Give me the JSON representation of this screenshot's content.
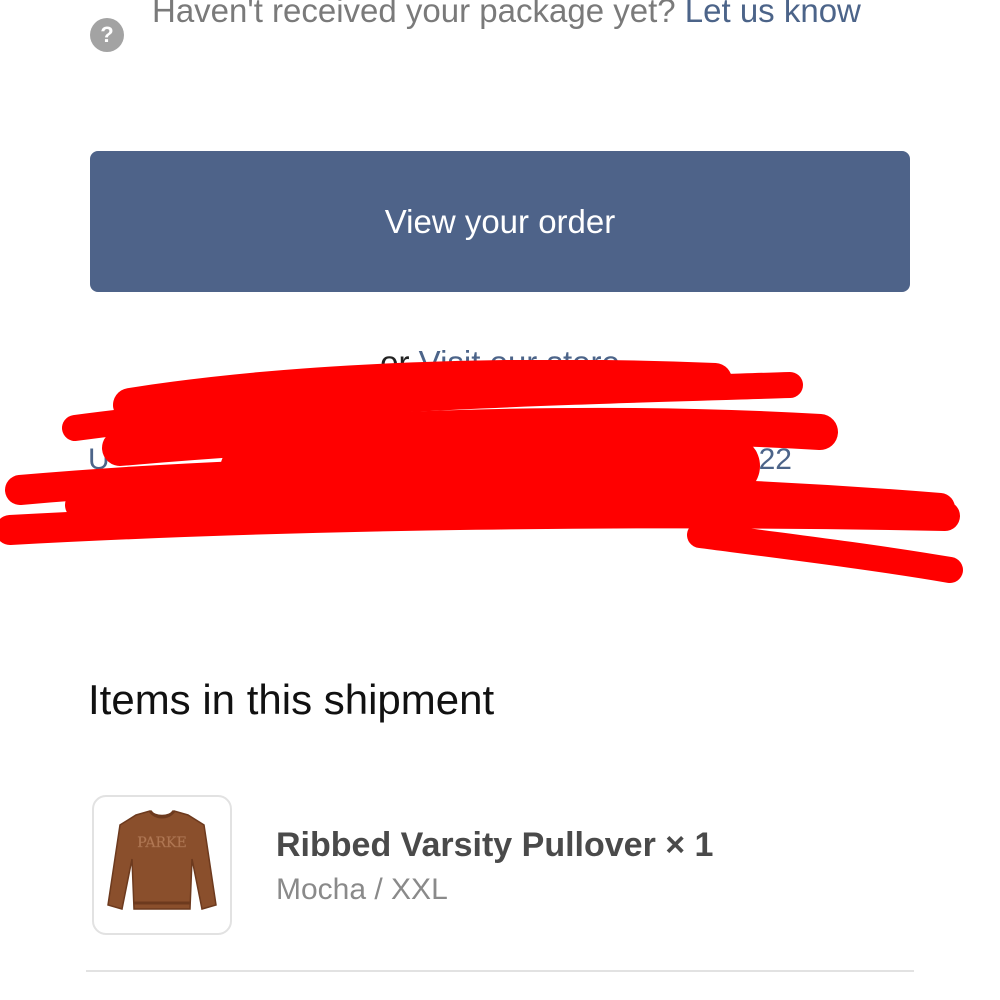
{
  "help": {
    "icon": "question-circle-icon",
    "text": "Haven't received your package yet?",
    "link": "Let us know"
  },
  "actions": {
    "view_order_label": "View your order",
    "or_text": "or",
    "store_link_label": "Visit our store"
  },
  "tracking": {
    "prefix_visible": "U",
    "number_tail_visible": "322"
  },
  "colors": {
    "accent": "#4e6389",
    "link": "#4c6489",
    "redaction": "#ff0000"
  },
  "items": {
    "heading": "Items in this shipment",
    "list": [
      {
        "name": "Ribbed Varsity Pullover × 1",
        "variant": "Mocha / XXL",
        "thumb_text": "PARKE",
        "thumb_color": "#8a4f2c"
      }
    ]
  }
}
